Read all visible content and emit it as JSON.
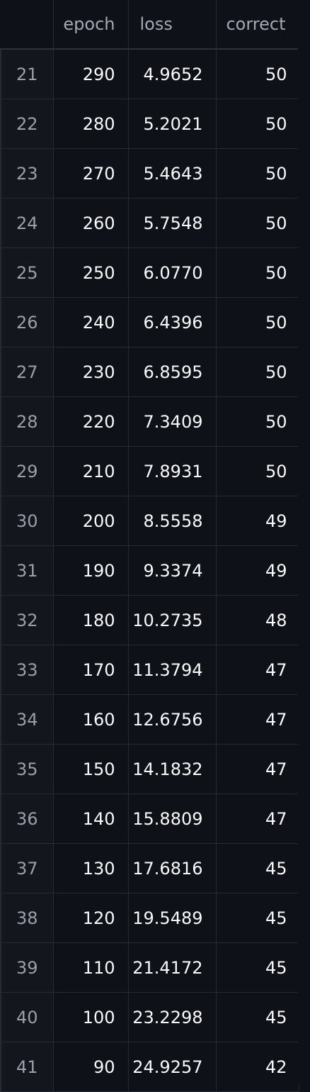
{
  "table": {
    "columns": [
      "",
      "epoch",
      "loss",
      "correct"
    ],
    "rows": [
      {
        "index": "21",
        "epoch": "290",
        "loss": "4.9652",
        "correct": "50"
      },
      {
        "index": "22",
        "epoch": "280",
        "loss": "5.2021",
        "correct": "50"
      },
      {
        "index": "23",
        "epoch": "270",
        "loss": "5.4643",
        "correct": "50"
      },
      {
        "index": "24",
        "epoch": "260",
        "loss": "5.7548",
        "correct": "50"
      },
      {
        "index": "25",
        "epoch": "250",
        "loss": "6.0770",
        "correct": "50"
      },
      {
        "index": "26",
        "epoch": "240",
        "loss": "6.4396",
        "correct": "50"
      },
      {
        "index": "27",
        "epoch": "230",
        "loss": "6.8595",
        "correct": "50"
      },
      {
        "index": "28",
        "epoch": "220",
        "loss": "7.3409",
        "correct": "50"
      },
      {
        "index": "29",
        "epoch": "210",
        "loss": "7.8931",
        "correct": "50"
      },
      {
        "index": "30",
        "epoch": "200",
        "loss": "8.5558",
        "correct": "49"
      },
      {
        "index": "31",
        "epoch": "190",
        "loss": "9.3374",
        "correct": "49"
      },
      {
        "index": "32",
        "epoch": "180",
        "loss": "10.2735",
        "correct": "48"
      },
      {
        "index": "33",
        "epoch": "170",
        "loss": "11.3794",
        "correct": "47"
      },
      {
        "index": "34",
        "epoch": "160",
        "loss": "12.6756",
        "correct": "47"
      },
      {
        "index": "35",
        "epoch": "150",
        "loss": "14.1832",
        "correct": "47"
      },
      {
        "index": "36",
        "epoch": "140",
        "loss": "15.8809",
        "correct": "47"
      },
      {
        "index": "37",
        "epoch": "130",
        "loss": "17.6816",
        "correct": "45"
      },
      {
        "index": "38",
        "epoch": "120",
        "loss": "19.5489",
        "correct": "45"
      },
      {
        "index": "39",
        "epoch": "110",
        "loss": "21.4172",
        "correct": "45"
      },
      {
        "index": "40",
        "epoch": "100",
        "loss": "23.2298",
        "correct": "45"
      },
      {
        "index": "41",
        "epoch": "90",
        "loss": "24.9257",
        "correct": "42"
      }
    ]
  }
}
